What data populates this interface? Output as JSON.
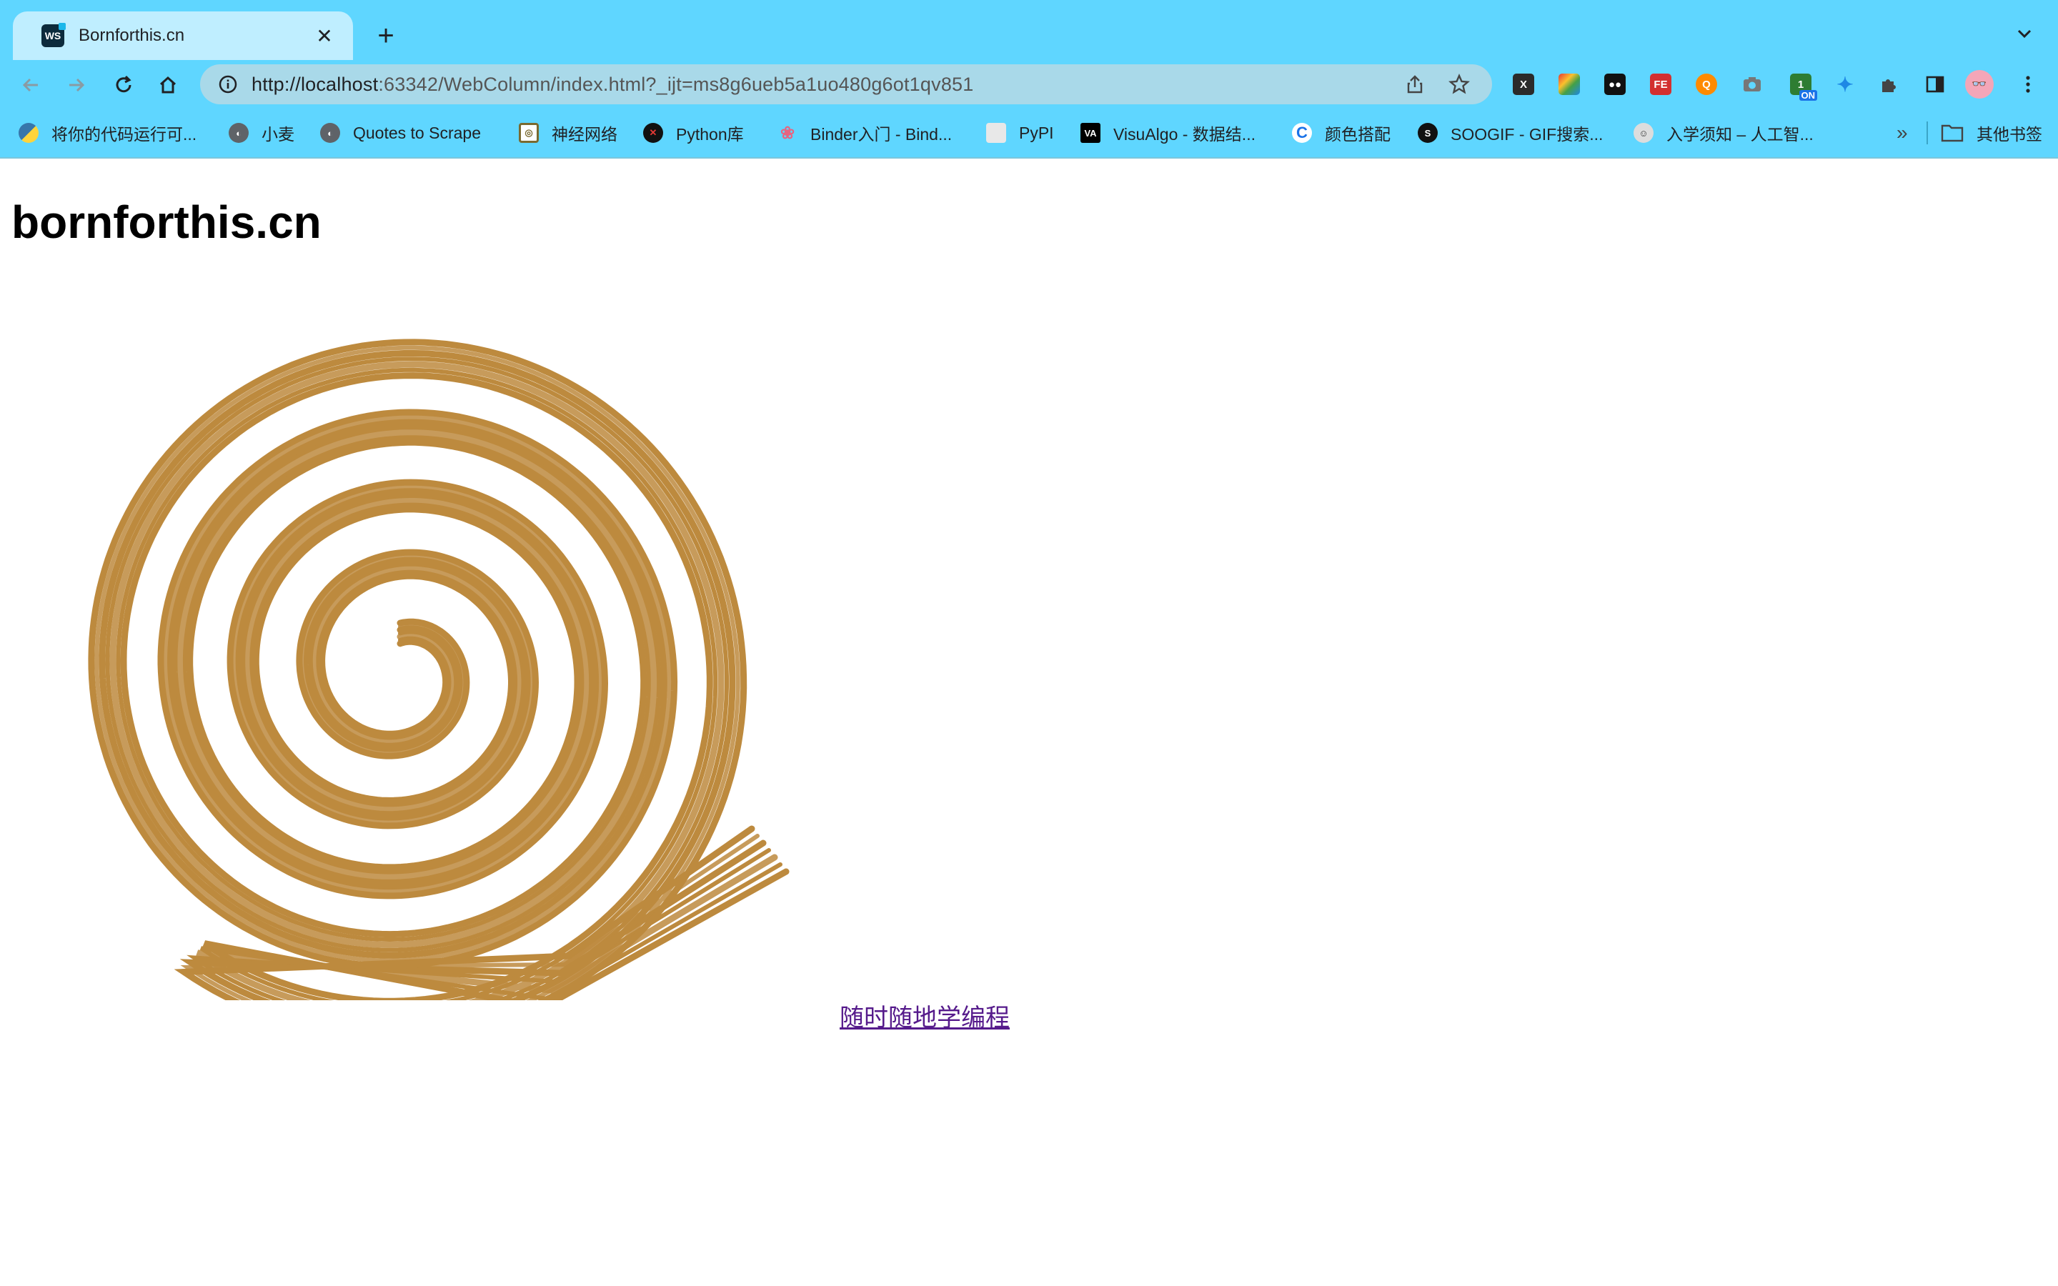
{
  "browser": {
    "tab": {
      "title": "Bornforthis.cn",
      "favicon": "ws-icon"
    },
    "address_bar": {
      "url_host": "http://localhost",
      "url_rest": ":63342/WebColumn/index.html?_ijt=ms8g6ueb5a1uo480g6ot1qv851"
    },
    "bookmarks": [
      {
        "label": "将你的代码运行可...",
        "icon": "python-icon",
        "color": "#3776ab"
      },
      {
        "label": "小麦",
        "icon": "globe-icon",
        "color": "#5f6368"
      },
      {
        "label": "Quotes to Scrape",
        "icon": "globe-icon",
        "color": "#5f6368"
      },
      {
        "label": "神经网络",
        "icon": "target-icon",
        "color": "#8a7a40"
      },
      {
        "label": "Python库",
        "icon": "python-lib-icon",
        "color": "#1a1a1a"
      },
      {
        "label": "Binder入门 - Bind...",
        "icon": "binder-icon",
        "color": "#e66581"
      },
      {
        "label": "PyPI",
        "icon": "pypi-icon",
        "color": "#e8e8e8"
      },
      {
        "label": "VisuAlgo - 数据结...",
        "icon": "visualgo-icon",
        "color": "#000000"
      },
      {
        "label": "颜色搭配",
        "icon": "color-icon",
        "color": "#1a73e8"
      },
      {
        "label": "SOOGIF - GIF搜索...",
        "icon": "soogif-icon",
        "color": "#111111"
      },
      {
        "label": "入学须知 – 人工智...",
        "icon": "avatar-icon",
        "color": "#777777"
      }
    ],
    "overflow_label": "»",
    "other_bookmarks": "其他书签"
  },
  "page": {
    "title": "bornforthis.cn",
    "link_text": "随时随地学编程",
    "spiral_color": "#bd8a3e"
  }
}
